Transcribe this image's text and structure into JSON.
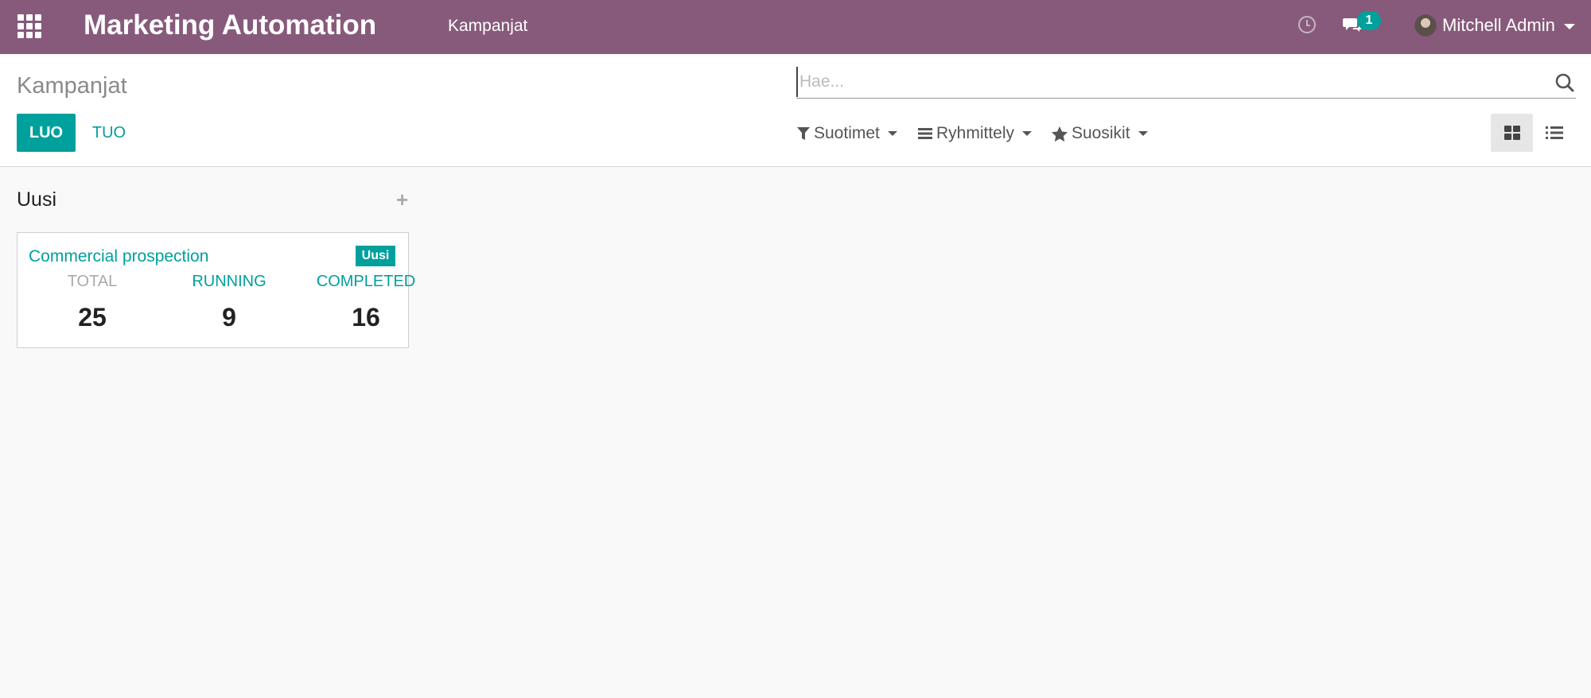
{
  "navbar": {
    "app_title": "Marketing Automation",
    "menu_item": "Kampanjat",
    "chat_count": "1",
    "user_name": "Mitchell Admin",
    "color": "#875a7b"
  },
  "control_panel": {
    "breadcrumb": "Kampanjat",
    "create_label": "LUO",
    "import_label": "TUO",
    "search_placeholder": "Hae...",
    "filters_label": "Suotimet",
    "group_by_label": "Ryhmittely",
    "favorites_label": "Suosikit"
  },
  "kanban": {
    "column_title": "Uusi",
    "card": {
      "title": "Commercial prospection",
      "badge": "Uusi",
      "stats": [
        {
          "label": "TOTAL",
          "value": "25",
          "color": "#aaaaaa"
        },
        {
          "label": "RUNNING",
          "value": "9",
          "color": "#00a09d"
        },
        {
          "label": "COMPLETED",
          "value": "16",
          "color": "#00a09d"
        }
      ]
    }
  },
  "colors": {
    "accent": "#00a09d",
    "brand": "#875a7b"
  }
}
